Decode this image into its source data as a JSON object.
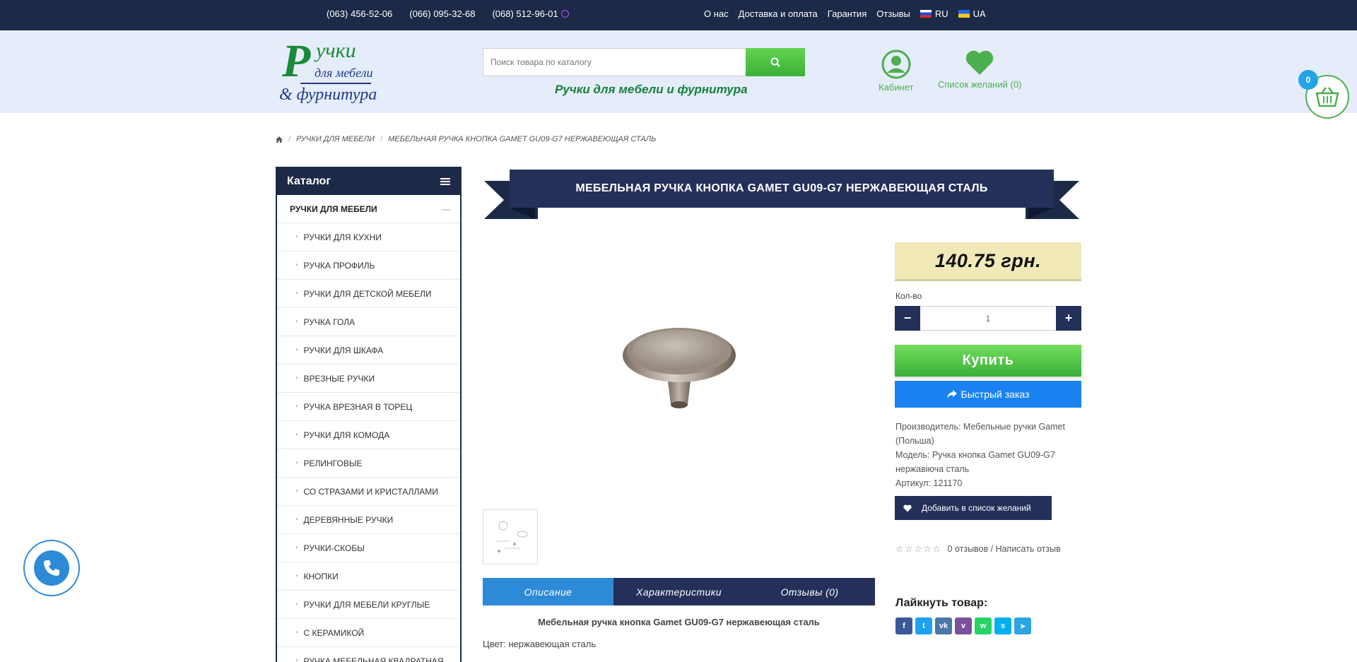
{
  "topbar": {
    "phones": [
      "(063) 456-52-06",
      "(066) 095-32-68",
      "(068) 512-96-01"
    ],
    "links": [
      "О нас",
      "Доставка и оплата",
      "Гарантия",
      "Отзывы"
    ],
    "lang_ru": "RU",
    "lang_ua": "UA"
  },
  "logo": {
    "big_letter": "Р",
    "line1": "учки",
    "line2": "для мебели",
    "line3": "& фурнитура"
  },
  "search": {
    "placeholder": "Поиск товара по каталогу"
  },
  "slogan": "Ручки для мебели и фурнитура",
  "header": {
    "cabinet": "Кабинет",
    "wishlist": "Список желаний (0)",
    "cart_count": "0"
  },
  "breadcrumb": [
    "РУЧКИ ДЛЯ МЕБЕЛИ",
    "МЕБЕЛЬНАЯ РУЧКА КНОПКА GAMET GU09-G7 НЕРЖАВЕЮЩАЯ СТАЛЬ"
  ],
  "catalog": {
    "title": "Каталог",
    "main": "РУЧКИ ДЛЯ МЕБЕЛИ",
    "items": [
      "РУЧКИ ДЛЯ КУХНИ",
      "РУЧКА ПРОФИЛЬ",
      "РУЧКИ ДЛЯ ДЕТСКОЙ МЕБЕЛИ",
      "РУЧКА ГОЛА",
      "РУЧКИ ДЛЯ ШКАФА",
      "ВРЕЗНЫЕ РУЧКИ",
      "РУЧКА ВРЕЗНАЯ В ТОРЕЦ",
      "РУЧКИ ДЛЯ КОМОДА",
      "РЕЛИНГОВЫЕ",
      "СО СТРАЗАМИ И КРИСТАЛЛАМИ",
      "ДЕРЕВЯННЫЕ РУЧКИ",
      "РУЧКИ-СКОБЫ",
      "КНОПКИ",
      "РУЧКИ ДЛЯ МЕБЕЛИ КРУГЛЫЕ",
      "С КЕРАМИКОЙ",
      "РУЧКА МЕБЕЛЬНАЯ КВАДРАТНАЯ"
    ]
  },
  "product": {
    "title": "МЕБЕЛЬНАЯ РУЧКА КНОПКА GAMET GU09-G7 НЕРЖАВЕЮЩАЯ СТАЛЬ",
    "price": "140.75 грн.",
    "qty_label": "Кол-во",
    "qty_value": "1",
    "buy": "Купить",
    "quick_order": "Быстрый заказ",
    "manufacturer": "Производитель: Мебельные ручки Gamet (Польша)",
    "model": "Модель: Ручка кнопка Gamet GU09-G7 нержавіюча сталь",
    "sku": "Артикул: 121170",
    "add_wishlist": "Добавить в список желаний",
    "reviews": "0 отзывов",
    "write_review": "Написать отзыв",
    "like": "Лайкнуть товар:"
  },
  "tabs": [
    "Описание",
    "Характеристики",
    "Отзывы (0)"
  ],
  "description": {
    "title": "Мебельная ручка кнопка Gamet GU09-G7 нержавеющая сталь",
    "color": "Цвет: нержавеющая сталь"
  },
  "colors": {
    "navy": "#1c2a47",
    "green": "#4caf50",
    "blue": "#2d8ad6",
    "price_bg": "#f1eab8"
  }
}
